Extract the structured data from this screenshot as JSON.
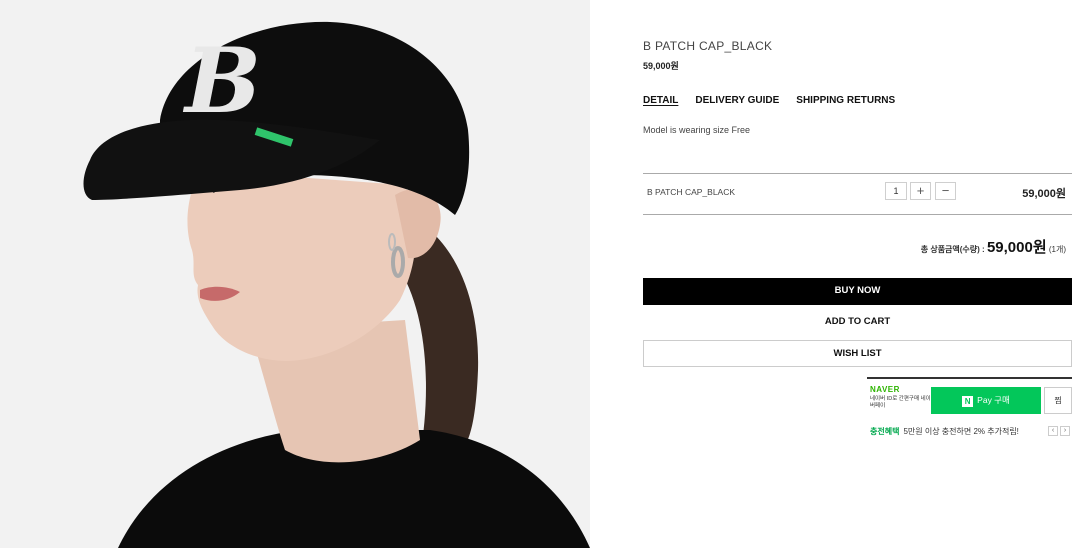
{
  "product": {
    "title": "B PATCH CAP_BLACK",
    "price": "59,000원"
  },
  "tabs": [
    {
      "label": "DETAIL",
      "active": true
    },
    {
      "label": "DELIVERY GUIDE",
      "active": false
    },
    {
      "label": "SHIPPING RETURNS",
      "active": false
    }
  ],
  "description": "Model is wearing size Free",
  "option": {
    "name": "B PATCH CAP_BLACK",
    "quantity": "1",
    "plus": "+",
    "minus": "−",
    "price": "59,000원"
  },
  "total": {
    "label": "총 상품금액(수량) : ",
    "amount": "59,000원",
    "count": " (1개)"
  },
  "buttons": {
    "buy_now": "BUY NOW",
    "add_to_cart": "ADD TO CART",
    "wish_list": "WISH LIST"
  },
  "naver": {
    "logo": "NAVER",
    "subtitle": "네이버 ID로 간편구매 네이버페이",
    "pay_n": "N",
    "pay_label": "Pay 구매",
    "jjim": "찜",
    "promo_highlight": "충전혜택",
    "promo_text": "5만원 이상 충전하면 2% 추가적립!",
    "prev": "‹",
    "next": "›"
  },
  "photo": {
    "cap_letter": "B",
    "background_color": "#f2f2f2",
    "cap_color": "#0d0d0d",
    "patch_color": "#2fc46b"
  },
  "colors": {
    "accent_naver": "#03c75a",
    "buy_button": "#000000"
  }
}
